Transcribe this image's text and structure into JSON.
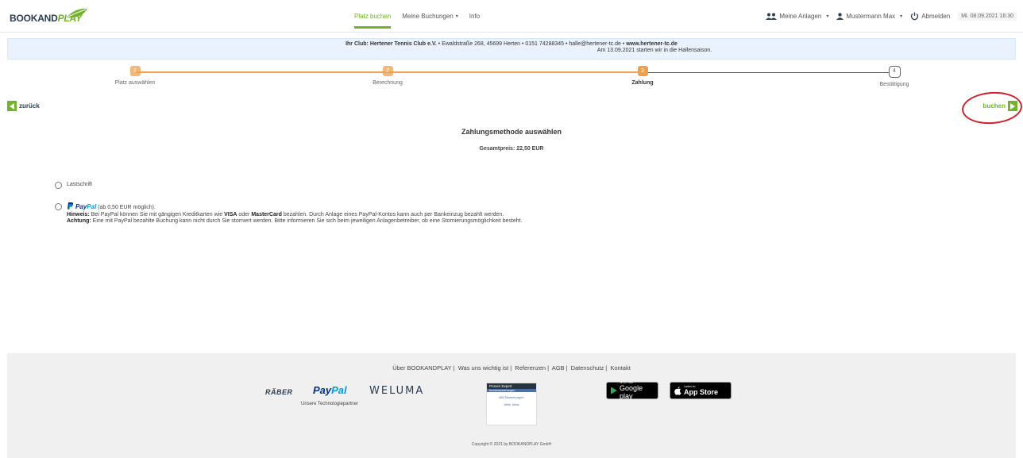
{
  "nav": {
    "logo": {
      "part1": "BOOKAND",
      "part2": "PLAY"
    },
    "links": [
      {
        "label": "Platz buchen",
        "active": true
      },
      {
        "label": "Meine Buchungen",
        "caret": "▾"
      },
      {
        "label": "Info"
      }
    ],
    "right": {
      "anlagen": "Meine Anlagen",
      "user": "Mustermann Max",
      "logout": "Abmelden",
      "datetime": "Mi. 08.09.2021 16:30"
    }
  },
  "club": {
    "label": "Ihr Club:",
    "name": "Hertener Tennis Club e.V.",
    "address": "Ewaldstraße 268, 45699 Herten",
    "phone": "0151 74288345",
    "email": "halle@hertener-tc.de",
    "web": "www.hertener-tc.de",
    "notice": "Am 13.09.2021 starten wir in die Hallensaison."
  },
  "steps": [
    {
      "num": "1",
      "label": "Platz auswählen",
      "state": "done"
    },
    {
      "num": "2",
      "label": "Berechnung",
      "state": "done"
    },
    {
      "num": "3",
      "label": "Zahlung",
      "state": "active"
    },
    {
      "num": "4",
      "label": "Bestätigung",
      "state": "pending"
    }
  ],
  "actions": {
    "back": "zurück",
    "forward": "buchen"
  },
  "payment": {
    "title": "Zahlungsmethode auswählen",
    "total": "Gesamtpreis: 22,50 EUR",
    "options": {
      "lastschrift": "Lastschrift",
      "paypal_p1": "Pay",
      "paypal_p2": "Pal",
      "paypal_min": "(ab 0,50 EUR möglich).",
      "hint_label": "Hinweis:",
      "hint_a": "Bei PayPal können Sie mit gängigen Kreditkarten wie",
      "hint_visa": "VISA",
      "hint_b": "oder",
      "hint_mc": "MasterCard",
      "hint_c": "bezahlen. Durch Anlage eines PayPal-Kontos kann auch per Bankeinzug bezahlt werden.",
      "warn_label": "Achtung:",
      "warn_text": "Eine mit PayPal bezahlte Buchung kann nicht durch Sie storniert werden. Bitte informieren Sie sich beim jeweiligen Anlagenbetreiber, ob eine Stornierungsmöglichkeit besteht."
    }
  },
  "footer": {
    "links": [
      "Über BOOKANDPLAY",
      "Was uns wichtig ist",
      "Referenzen",
      "AGB",
      "Datenschutz",
      "Kontakt"
    ],
    "partners": {
      "raeber": "RÄBER",
      "paypal1": "Pay",
      "paypal2": "Pal",
      "weluma": "WELUMA",
      "caption": "Unsere Technologiepartner"
    },
    "proven": {
      "brand": "Proven Expert",
      "sub": "Kundenbewertungen",
      "count": "882 Bewertungen",
      "more": "Mehr Infos"
    },
    "google": {
      "small": "JETZT BEI",
      "big": "Google play"
    },
    "apple": {
      "small": "Laden im",
      "big": "App Store"
    },
    "copyright": "Copyright © 2021 by BOOKANDPLAY GmbH"
  },
  "colors": {
    "accent": "#71b42a",
    "orange": "#f0a04b",
    "highlight_circle": "#d0222b"
  }
}
